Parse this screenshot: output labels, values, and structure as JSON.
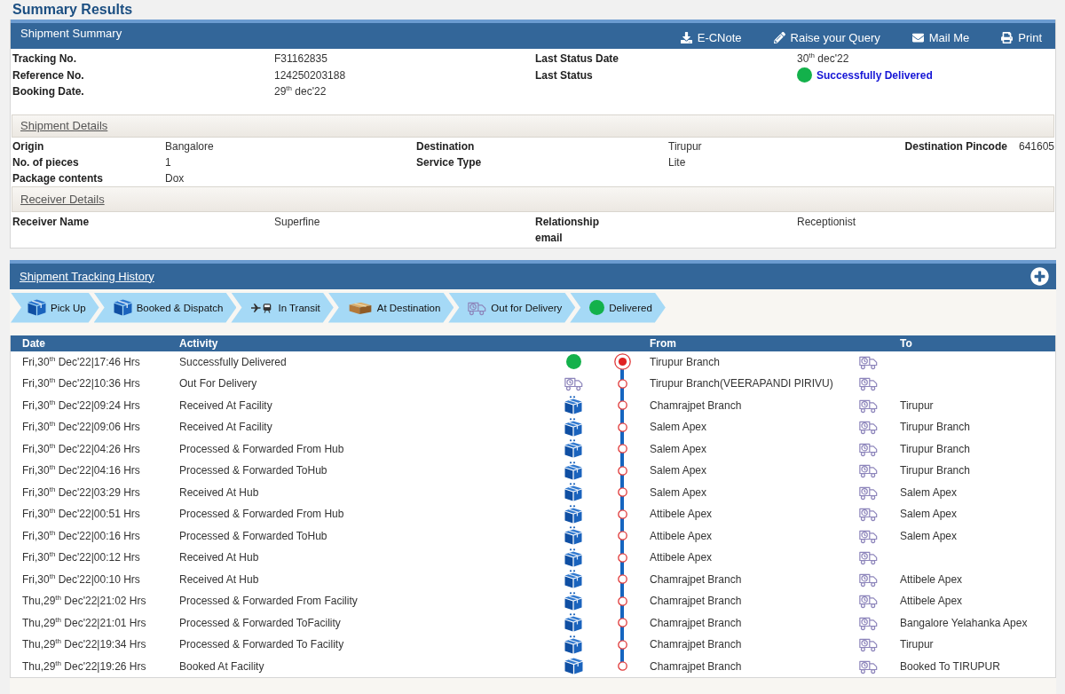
{
  "page_title": "Summary Results",
  "summary": {
    "title": "Shipment Summary",
    "actions": [
      {
        "label": "E-CNote",
        "kind": "download"
      },
      {
        "label": "Raise your Query",
        "kind": "edit"
      },
      {
        "label": "Mail Me",
        "kind": "mail"
      },
      {
        "label": "Print",
        "kind": "print"
      }
    ],
    "rows": [
      [
        {
          "label": "Tracking No.",
          "value": "F31162835",
          "kind": "text"
        },
        {
          "label": "Last Status Date",
          "value": "30$^{th}$ dec'22",
          "kind": "text"
        }
      ],
      [
        {
          "label": "Reference No.",
          "value": "124250203188",
          "kind": "text"
        },
        {
          "label": "Last Status",
          "value": "Successfully Delivered",
          "kind": "status"
        }
      ],
      [
        {
          "label": "Booking Date.",
          "value": "29$^{th}$ dec'22",
          "kind": "text"
        }
      ]
    ]
  },
  "shipment_details": {
    "title": "Shipment Details",
    "rows": [
      [
        {
          "label": "Origin",
          "value": "Bangalore"
        },
        {
          "label": "Destination",
          "value": "Tirupur"
        },
        {
          "label": "Destination Pincode",
          "value": "641605"
        }
      ],
      [
        {
          "label": "No. of pieces",
          "value": "1"
        },
        {
          "label": "Service Type",
          "value": "Lite"
        }
      ],
      [
        {
          "label": "Package contents",
          "value": "Dox"
        }
      ]
    ]
  },
  "receiver_details": {
    "title": "Receiver Details",
    "rows": [
      [
        {
          "label": "Receiver Name",
          "value": "Superfine"
        },
        {
          "label": "Relationship",
          "value": "Receptionist"
        }
      ],
      [
        null,
        {
          "label": "email"
        }
      ]
    ]
  },
  "tracking": {
    "title": "Shipment Tracking History",
    "steps": [
      {
        "label": "Pick Up",
        "kind": "box"
      },
      {
        "label": "Booked & Dispatch",
        "kind": "box"
      },
      {
        "label": "In Transit",
        "kind": "transit"
      },
      {
        "label": "At Destination",
        "kind": "parcel"
      },
      {
        "label": "Out for Delivery",
        "kind": "truck"
      },
      {
        "label": "Delivered",
        "kind": "delivered"
      }
    ],
    "table": {
      "columns": {
        "date": "Date",
        "activity": "Activity",
        "from": "From",
        "to": "To"
      },
      "rows": [
        {
          "date": "Fri,30$^{th}$ Dec'22|17:46 Hrs",
          "activity": "Successfully Delivered",
          "kind": "delivered",
          "current": true,
          "from": "Tirupur Branch"
        },
        {
          "date": "Fri,30$^{th}$ Dec'22|10:36 Hrs",
          "activity": "Out For Delivery",
          "kind": "truck",
          "current": false,
          "from": "Tirupur Branch(VEERAPANDI PIRIVU)"
        },
        {
          "date": "Fri,30$^{th}$ Dec'22|09:24 Hrs",
          "activity": "Received At Facility",
          "kind": "package",
          "current": false,
          "from": "Chamrajpet Branch",
          "to": "Tirupur"
        },
        {
          "date": "Fri,30$^{th}$ Dec'22|09:06 Hrs",
          "activity": "Received At Facility",
          "kind": "package",
          "current": false,
          "from": "Salem Apex",
          "to": "Tirupur Branch"
        },
        {
          "date": "Fri,30$^{th}$ Dec'22|04:26 Hrs",
          "activity": "Processed & Forwarded From Hub",
          "kind": "package",
          "current": false,
          "from": "Salem Apex",
          "to": "Tirupur Branch"
        },
        {
          "date": "Fri,30$^{th}$ Dec'22|04:16 Hrs",
          "activity": "Processed & Forwarded ToHub",
          "kind": "package",
          "current": false,
          "from": "Salem Apex",
          "to": "Tirupur Branch"
        },
        {
          "date": "Fri,30$^{th}$ Dec'22|03:29 Hrs",
          "activity": "Received At Hub",
          "kind": "package",
          "current": false,
          "from": "Salem Apex",
          "to": "Salem Apex"
        },
        {
          "date": "Fri,30$^{th}$ Dec'22|00:51 Hrs",
          "activity": "Processed & Forwarded From Hub",
          "kind": "package",
          "current": false,
          "from": "Attibele Apex",
          "to": "Salem Apex"
        },
        {
          "date": "Fri,30$^{th}$ Dec'22|00:16 Hrs",
          "activity": "Processed & Forwarded ToHub",
          "kind": "package",
          "current": false,
          "from": "Attibele Apex",
          "to": "Salem Apex"
        },
        {
          "date": "Fri,30$^{th}$ Dec'22|00:12 Hrs",
          "activity": "Received At Hub",
          "kind": "package",
          "current": false,
          "from": "Attibele Apex"
        },
        {
          "date": "Fri,30$^{th}$ Dec'22|00:10 Hrs",
          "activity": "Received At Hub",
          "kind": "package",
          "current": false,
          "from": "Chamrajpet Branch",
          "to": "Attibele Apex"
        },
        {
          "date": "Thu,29$^{th}$ Dec'22|21:02 Hrs",
          "activity": "Processed & Forwarded From Facility",
          "kind": "package",
          "current": false,
          "from": "Chamrajpet Branch",
          "to": "Attibele Apex"
        },
        {
          "date": "Thu,29$^{th}$ Dec'22|21:01 Hrs",
          "activity": "Processed & Forwarded ToFacility",
          "kind": "package",
          "current": false,
          "from": "Chamrajpet Branch",
          "to": "Bangalore Yelahanka Apex"
        },
        {
          "date": "Thu,29$^{th}$ Dec'22|19:34 Hrs",
          "activity": "Processed & Forwarded To Facility",
          "kind": "package",
          "current": false,
          "from": "Chamrajpet Branch",
          "to": "Tirupur"
        },
        {
          "date": "Thu,29$^{th}$ Dec'22|19:26 Hrs",
          "activity": "Booked At Facility",
          "kind": "booked",
          "current": false,
          "from": "Chamrajpet Branch",
          "to": "Booked To TIRUPUR"
        }
      ]
    }
  }
}
